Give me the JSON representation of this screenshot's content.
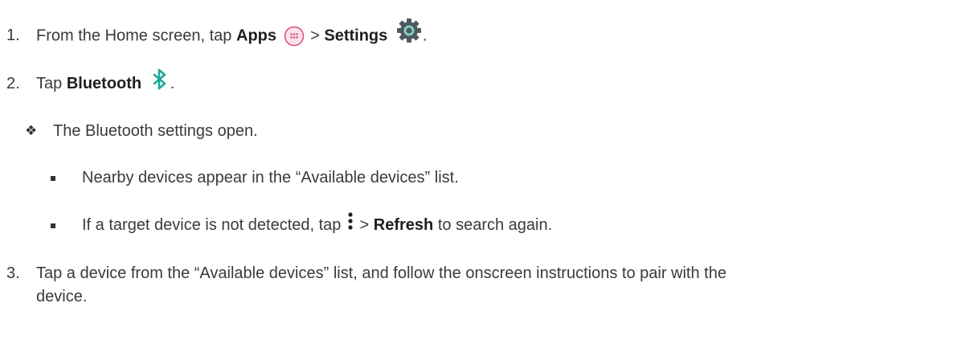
{
  "steps": [
    {
      "number": "1.",
      "prefix": "From the Home screen, tap",
      "apps_label": "Apps",
      "separator": ">",
      "settings_label": "Settings",
      "suffix": ".",
      "icons": [
        "apps-icon",
        "settings-gear-icon"
      ]
    },
    {
      "number": "2.",
      "prefix": "Tap",
      "bluetooth_label": "Bluetooth",
      "suffix": ".",
      "icons": [
        "bluetooth-icon"
      ]
    },
    {
      "number": "3.",
      "line1": "Tap a device from the “Available devices” list, and follow the onscreen instructions to pair with the",
      "line2": "device."
    }
  ],
  "result": {
    "bullet": "❖",
    "text": "The Bluetooth settings open."
  },
  "subitems": [
    {
      "text": "Nearby devices appear in the “Available devices” list."
    },
    {
      "prefix": "If a target device is not detected, tap",
      "separator": ">",
      "refresh_label": "Refresh",
      "suffix": "to search again.",
      "icons": [
        "more-options-icon"
      ]
    }
  ],
  "colors": {
    "text": "#3a3a3a",
    "apps_icon": "#d9537e",
    "settings_icon": "#4f5a60",
    "bluetooth_icon": "#1aa99a"
  }
}
